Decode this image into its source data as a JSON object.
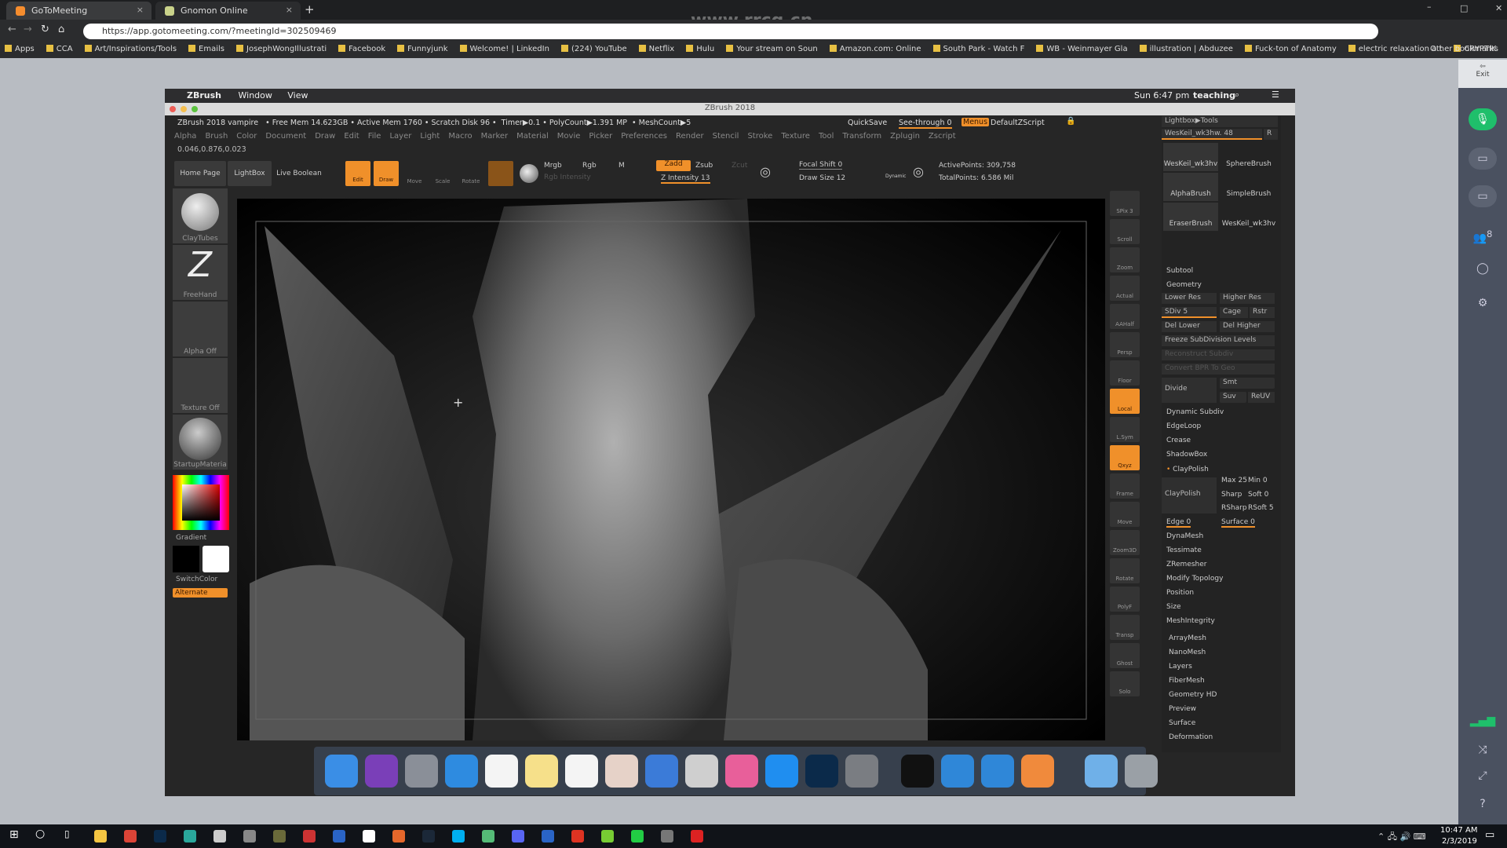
{
  "watermark": "www.rrcg.cn",
  "browser": {
    "tabs": [
      {
        "title": "GoToMeeting",
        "color": "#f68d2e"
      },
      {
        "title": "Gnomon Online",
        "color": "#c9d28a"
      }
    ],
    "url": "https://app.gotomeeting.com/?meetingId=302509469",
    "bookmarks": [
      "Apps",
      "CCA",
      "Art/Inspirations/Tools",
      "Emails",
      "JosephWongIllustrati",
      "Facebook",
      "Funnyjunk",
      "Welcome! | LinkedIn",
      "(224) YouTube",
      "Netflix",
      "Hulu",
      "Your stream on Soun",
      "Amazon.com: Online",
      "South Park - Watch F",
      "WB - Weinmayer Gla",
      "illustration | Abduzee",
      "Fuck-ton of Anatomy",
      "electric relaxation a t",
      "CRYPTIK"
    ],
    "other_bookmarks": "Other bookmarks"
  },
  "gotomeeting": {
    "exit": "Exit",
    "participants": "8",
    "mic_color": "#1fbf6b"
  },
  "mac": {
    "menu": [
      "ZBrush",
      "Window",
      "View"
    ],
    "clock": "Sun 6:47 pm",
    "user": "teaching",
    "window_title": "ZBrush 2018"
  },
  "zbrush": {
    "info": "ZBrush 2018 vampire   • Free Mem 14.623GB • Active Mem 1760 • Scratch Disk 96 •  Timer▶0.1 • PolyCount▶1.391 MP  • MeshCount▶5",
    "quicksave": "QuickSave",
    "see_through": "See-through  0",
    "menus": "Menus",
    "default_zscript": "DefaultZScript",
    "menu": [
      "Alpha",
      "Brush",
      "Color",
      "Document",
      "Draw",
      "Edit",
      "File",
      "Layer",
      "Light",
      "Macro",
      "Marker",
      "Material",
      "Movie",
      "Picker",
      "Preferences",
      "Render",
      "Stencil",
      "Stroke",
      "Texture",
      "Tool",
      "Transform",
      "Zplugin",
      "Zscript"
    ],
    "coords": "0.046,0.876,0.023",
    "toolbar": {
      "home_page": "Home Page",
      "lightbox": "LightBox",
      "live_boolean": "Live Boolean",
      "edit": "Edit",
      "draw": "Draw",
      "move": "Move",
      "scale": "Scale",
      "rotate": "Rotate",
      "mrgb": "Mrgb",
      "rgb": "Rgb",
      "m": "M",
      "rgb_intensity": "Rgb Intensity",
      "zadd": "Zadd",
      "zsub": "Zsub",
      "zcut": "Zcut",
      "z_intensity": "Z Intensity 13",
      "focal_shift": "Focal Shift 0",
      "draw_size": "Draw Size 12",
      "dynamic": "Dynamic",
      "active_points": "ActivePoints: 309,758",
      "total_points": "TotalPoints: 6.586 Mil"
    },
    "shelf": {
      "brush": "ClayTubes",
      "stroke": "FreeHand",
      "alpha": "Alpha Off",
      "texture": "Texture Off",
      "material": "StartupMateria",
      "gradient": "Gradient",
      "switch_color": "SwitchColor",
      "alternate": "Alternate"
    },
    "right_icons": [
      "SPix 3",
      "Scroll",
      "Zoom",
      "Actual",
      "AAHalf",
      "Persp",
      "Floor",
      "Local",
      "L.Sym",
      "Qxyz",
      "Frame",
      "Move",
      "Zoom3D",
      "Rotate",
      "PolyF",
      "Transp",
      "Ghost",
      "Solo"
    ],
    "panel": {
      "lightbox_tools": "Lightbox▶Tools",
      "tool_name": "WesKeil_wk3hw. 48",
      "r": "R",
      "thumbs": [
        "WesKeil_wk3hv",
        "SphereBrush",
        "AlphaBrush",
        "SimpleBrush",
        "EraserBrush",
        "WesKeil_wk3hv"
      ],
      "thumb_badge": "8",
      "subtool": "Subtool",
      "geometry": "Geometry",
      "lower_res": "Lower Res",
      "higher_res": "Higher Res",
      "sdiv": "SDiv 5",
      "cage": "Cage",
      "rstr": "Rstr",
      "del_lower": "Del Lower",
      "del_higher": "Del Higher",
      "freeze": "Freeze SubDivision Levels",
      "reconstruct": "Reconstruct Subdiv",
      "convert_bpr": "Convert BPR To Geo",
      "divide": "Divide",
      "smt": "Smt",
      "suv": "Suv",
      "reuv": "ReUV",
      "geo_items": [
        "Dynamic Subdiv",
        "EdgeLoop",
        "Crease",
        "ShadowBox"
      ],
      "claypolish": "ClayPolish",
      "max": "Max 25",
      "min": "Min 0",
      "sharp": "Sharp",
      "soft": "Soft 0",
      "rsharp": "RSharp",
      "rsoft": "RSoft 5",
      "edge": "Edge 0",
      "surface": "Surface 0",
      "geo_items2": [
        "DynaMesh",
        "Tessimate",
        "ZRemesher",
        "Modify Topology",
        "Position",
        "Size",
        "MeshIntegrity"
      ],
      "sections": [
        "ArrayMesh",
        "NanoMesh",
        "Layers",
        "FiberMesh",
        "Geometry HD",
        "Preview",
        "Surface",
        "Deformation"
      ]
    },
    "accent": "#f0902a"
  },
  "dock": [
    {
      "icon": "finder-icon",
      "color": "#3a8ee6"
    },
    {
      "icon": "siri-icon",
      "color": "#7a3fb8"
    },
    {
      "icon": "launchpad-icon",
      "color": "#8a8f98"
    },
    {
      "icon": "safari-icon",
      "color": "#2e8be0"
    },
    {
      "icon": "calendar-icon",
      "color": "#f4f4f4"
    },
    {
      "icon": "notes-icon",
      "color": "#f6e08a"
    },
    {
      "icon": "reminders-icon",
      "color": "#f4f4f4"
    },
    {
      "icon": "photos-icon",
      "color": "#e6d2c8"
    },
    {
      "icon": "keynote-icon",
      "color": "#3b7bd8"
    },
    {
      "icon": "zbrush-icon",
      "color": "#cfcfcf"
    },
    {
      "icon": "itunes-icon",
      "color": "#e85f9a"
    },
    {
      "icon": "app-store-icon",
      "color": "#1f8ef0"
    },
    {
      "icon": "photoshop-icon",
      "color": "#0b2a4a"
    },
    {
      "icon": "system-preferences-icon",
      "color": "#7a7d82"
    },
    {
      "icon": "terminal-icon",
      "color": "#111111"
    },
    {
      "icon": "browser-icon",
      "color": "#2f87d8"
    },
    {
      "icon": "browser-icon",
      "color": "#2f87d8"
    },
    {
      "icon": "flower-icon",
      "color": "#f08a3c"
    },
    {
      "icon": "folder-icon",
      "color": "#6fb0e8"
    },
    {
      "icon": "trash-icon",
      "color": "#9aa0a6"
    }
  ],
  "taskbar": {
    "time": "10:47 AM",
    "date": "2/3/2019",
    "apps": [
      "#f4c542",
      "#db4437",
      "#0b2a4a",
      "#2aa79b",
      "#ccc",
      "#888",
      "#6a6a3a",
      "#c33",
      "#2a64c5",
      "#fff",
      "#e5672b",
      "#1b2838",
      "#00aff0",
      "#5b7",
      "#5865f2",
      "#2a64c5",
      "#d32",
      "#7c3",
      "#2c4",
      "#777",
      "#d22"
    ]
  }
}
